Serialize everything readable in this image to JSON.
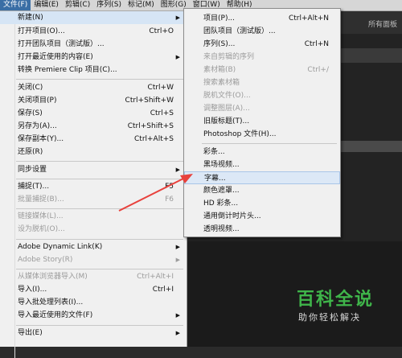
{
  "menubar": [
    {
      "label": "文件(F)",
      "active": true
    },
    {
      "label": "编辑(E)"
    },
    {
      "label": "剪辑(C)"
    },
    {
      "label": "序列(S)"
    },
    {
      "label": "标记(M)"
    },
    {
      "label": "图形(G)"
    },
    {
      "label": "窗口(W)"
    },
    {
      "label": "帮助(H)"
    }
  ],
  "app": {
    "workspace_label": "所有面板"
  },
  "file_menu": {
    "items": [
      {
        "label": "新建(N)",
        "shortcut": "",
        "submenu": true
      },
      {
        "label": "打开项目(O)...",
        "shortcut": "Ctrl+O"
      },
      {
        "label": "打开团队项目（测试版）...",
        "shortcut": ""
      },
      {
        "label": "打开最近使用的内容(E)",
        "shortcut": "",
        "submenu": true
      },
      {
        "label": "转换 Premiere Clip 项目(C)...",
        "shortcut": ""
      },
      {
        "label": "关闭(C)",
        "shortcut": "Ctrl+W"
      },
      {
        "label": "关闭项目(P)",
        "shortcut": "Ctrl+Shift+W"
      },
      {
        "label": "保存(S)",
        "shortcut": "Ctrl+S"
      },
      {
        "label": "另存为(A)...",
        "shortcut": "Ctrl+Shift+S"
      },
      {
        "label": "保存副本(Y)...",
        "shortcut": "Ctrl+Alt+S"
      },
      {
        "label": "还原(R)",
        "shortcut": ""
      },
      {
        "label": "同步设置",
        "shortcut": "",
        "submenu": true
      },
      {
        "label": "捕捉(T)...",
        "shortcut": "F5"
      },
      {
        "label": "批量捕捉(B)...",
        "shortcut": "F6",
        "disabled": true
      },
      {
        "label": "链接媒体(L)...",
        "shortcut": "",
        "disabled": true
      },
      {
        "label": "设为脱机(O)...",
        "shortcut": "",
        "disabled": true
      },
      {
        "label": "Adobe Dynamic Link(K)",
        "shortcut": "",
        "submenu": true
      },
      {
        "label": "Adobe Story(R)",
        "shortcut": "",
        "submenu": true,
        "disabled": true
      },
      {
        "label": "从媒体浏览器导入(M)",
        "shortcut": "Ctrl+Alt+I",
        "disabled": true
      },
      {
        "label": "导入(I)...",
        "shortcut": "Ctrl+I"
      },
      {
        "label": "导入批处理列表(I)...",
        "shortcut": ""
      },
      {
        "label": "导入最近使用的文件(F)",
        "shortcut": "",
        "submenu": true
      },
      {
        "label": "导出(E)",
        "shortcut": "",
        "submenu": true
      }
    ]
  },
  "new_submenu": {
    "items": [
      {
        "label": "项目(P)...",
        "shortcut": "Ctrl+Alt+N"
      },
      {
        "label": "团队项目（测试版）...",
        "shortcut": ""
      },
      {
        "label": "序列(S)...",
        "shortcut": "Ctrl+N"
      },
      {
        "label": "来自剪辑的序列",
        "shortcut": "",
        "disabled": true
      },
      {
        "label": "素材箱(B)",
        "shortcut": "Ctrl+/",
        "disabled": true
      },
      {
        "label": "搜索素材箱",
        "shortcut": "",
        "disabled": true
      },
      {
        "label": "脱机文件(O)...",
        "shortcut": "",
        "disabled": true
      },
      {
        "label": "调整图层(A)...",
        "shortcut": "",
        "disabled": true
      },
      {
        "label": "旧版标题(T)...",
        "shortcut": ""
      },
      {
        "label": "Photoshop 文件(H)...",
        "shortcut": ""
      },
      {
        "label": "彩条...",
        "shortcut": ""
      },
      {
        "label": "黑场视频...",
        "shortcut": ""
      },
      {
        "label": "字幕...",
        "shortcut": "",
        "highlight": true
      },
      {
        "label": "颜色遮罩...",
        "shortcut": ""
      },
      {
        "label": "HD 彩条...",
        "shortcut": ""
      },
      {
        "label": "通用倒计时片头...",
        "shortcut": ""
      },
      {
        "label": "透明视频...",
        "shortcut": ""
      }
    ]
  },
  "watermark": {
    "logo": "百科全说",
    "tagline": "助你轻松解决"
  },
  "colors": {
    "accent": "#3a6ea5",
    "arrow": "#e8413c",
    "watermark_green": "#3fb54a"
  }
}
